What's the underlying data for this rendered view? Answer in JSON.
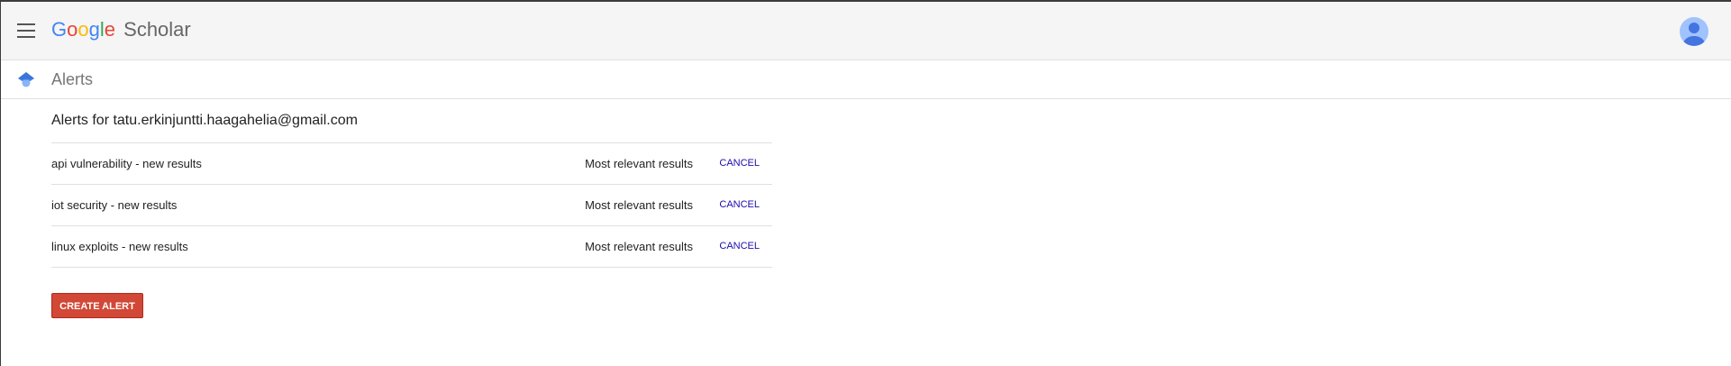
{
  "header": {
    "logo": {
      "letters": [
        {
          "char": "G",
          "color": "#4285f4"
        },
        {
          "char": "o",
          "color": "#ea4335"
        },
        {
          "char": "o",
          "color": "#fbbc05"
        },
        {
          "char": "g",
          "color": "#4285f4"
        },
        {
          "char": "l",
          "color": "#34a853"
        },
        {
          "char": "e",
          "color": "#ea4335"
        }
      ],
      "product": "Scholar"
    },
    "menu_icon": "hamburger-menu-icon",
    "avatar_icon": "account-avatar-icon"
  },
  "subheader": {
    "icon": "scholar-cap-icon",
    "title": "Alerts"
  },
  "main": {
    "heading": "Alerts for tatu.erkinjuntti.haagahelia@gmail.com",
    "alerts": [
      {
        "query": "api vulnerability - new results",
        "frequency": "Most relevant results",
        "action": "CANCEL"
      },
      {
        "query": "iot security - new results",
        "frequency": "Most relevant results",
        "action": "CANCEL"
      },
      {
        "query": "linux exploits - new results",
        "frequency": "Most relevant results",
        "action": "CANCEL"
      }
    ],
    "create_button": "CREATE ALERT"
  },
  "colors": {
    "accent_red": "#d14836",
    "link_blue": "#1a0dab",
    "header_bg": "#f5f5f5"
  }
}
